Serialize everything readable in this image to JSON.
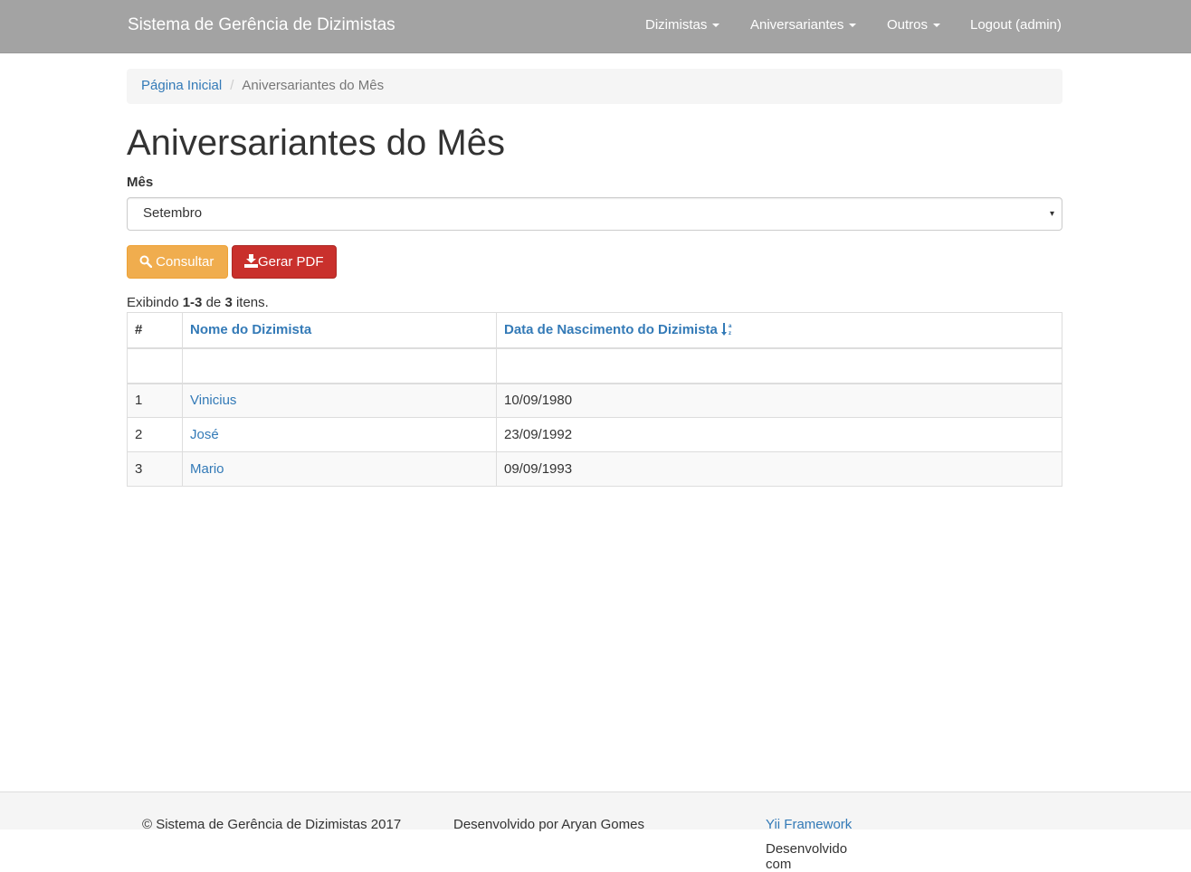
{
  "navbar": {
    "brand": "Sistema de Gerência de Dizimistas",
    "items": [
      {
        "label": "Dizimistas"
      },
      {
        "label": "Aniversariantes"
      },
      {
        "label": "Outros"
      }
    ],
    "logout": "Logout (admin)"
  },
  "breadcrumb": {
    "home": "Página Inicial",
    "separator": "/",
    "current": "Aniversariantes do Mês"
  },
  "page": {
    "title": "Aniversariantes do Mês",
    "month_label": "Mês",
    "month_value": "Setembro"
  },
  "buttons": {
    "consultar": "Consultar",
    "gerar_pdf": "Gerar PDF"
  },
  "summary": {
    "prefix": "Exibindo",
    "range": "1-3",
    "middle": "de",
    "total": "3",
    "suffix": "itens."
  },
  "table": {
    "headers": [
      "#",
      "Nome do Dizimista",
      "Data de Nascimento do Dizimista"
    ],
    "rows": [
      {
        "n": "1",
        "nome": "Vinicius",
        "data": "10/09/1980"
      },
      {
        "n": "2",
        "nome": "José",
        "data": "23/09/1992"
      },
      {
        "n": "3",
        "nome": "Mario",
        "data": "09/09/1993"
      }
    ]
  },
  "footer": {
    "copyright": "© Sistema de Gerência de Dizimistas 2017",
    "developer": "Desenvolvido por Aryan Gomes",
    "powered_prefix": "Desenvolvido com",
    "powered_link": "Yii Framework"
  },
  "colors": {
    "navbar": "#a3a3a3",
    "link": "#337ab7",
    "warning": "#f0ad4e",
    "danger": "#c9302c"
  }
}
